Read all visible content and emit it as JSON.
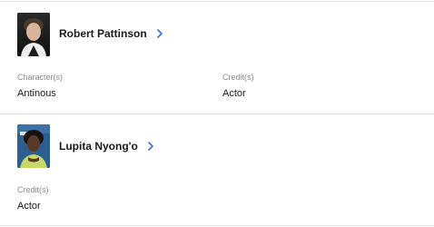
{
  "cast": [
    {
      "name": "Robert Pattinson",
      "character_label": "Character(s)",
      "character_value": "Antinous",
      "credit_label": "Credit(s)",
      "credit_value": "Actor"
    },
    {
      "name": "Lupita Nyong'o",
      "credit_label": "Credit(s)",
      "credit_value": "Actor"
    }
  ],
  "colors": {
    "link_chevron": "#3a6fd8",
    "divider": "#e2e2e2",
    "label": "#8a8a8a"
  },
  "icons": [
    "chevron-right-icon"
  ]
}
